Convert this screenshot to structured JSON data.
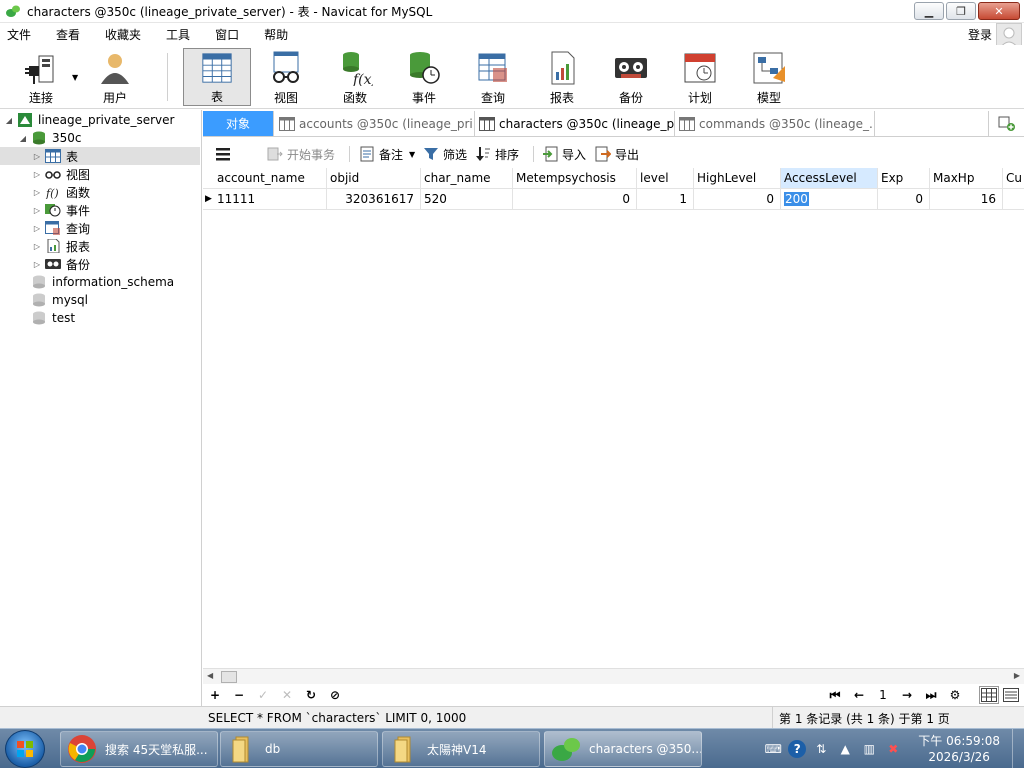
{
  "window": {
    "title": "characters @350c (lineage_private_server) - 表 - Navicat for MySQL",
    "controls": [
      "minimize",
      "restore",
      "close"
    ]
  },
  "menu": {
    "items": [
      "文件",
      "查看",
      "收藏夹",
      "工具",
      "窗口",
      "帮助"
    ],
    "login": "登录"
  },
  "toolbar": {
    "buttons": [
      {
        "label": "连接",
        "icon": "plug-icon"
      },
      {
        "label": "用户",
        "icon": "user-icon"
      },
      {
        "label": "表",
        "icon": "table-icon",
        "active": true
      },
      {
        "label": "视图",
        "icon": "view-glasses-icon"
      },
      {
        "label": "函数",
        "icon": "function-icon"
      },
      {
        "label": "事件",
        "icon": "event-clock-icon"
      },
      {
        "label": "查询",
        "icon": "query-icon"
      },
      {
        "label": "报表",
        "icon": "report-icon"
      },
      {
        "label": "备份",
        "icon": "backup-tape-icon"
      },
      {
        "label": "计划",
        "icon": "calendar-icon"
      },
      {
        "label": "模型",
        "icon": "model-icon"
      }
    ]
  },
  "tree": {
    "connection": "lineage_private_server",
    "database": "350c",
    "nodes": [
      "表",
      "视图",
      "函数",
      "事件",
      "查询",
      "报表",
      "备份"
    ],
    "other_databases": [
      "information_schema",
      "mysql",
      "test"
    ]
  },
  "tabs": [
    {
      "label": "对象"
    },
    {
      "label": "accounts @350c (lineage_pri..."
    },
    {
      "label": "characters @350c (lineage_p..."
    },
    {
      "label": "commands @350c (lineage_..."
    }
  ],
  "table_toolbar": {
    "begin_tx": "开始事务",
    "memo": "备注",
    "filter": "筛选",
    "sort": "排序",
    "import": "导入",
    "export": "导出"
  },
  "grid": {
    "columns": [
      "account_name",
      "objid",
      "char_name",
      "Metempsychosis",
      "level",
      "HighLevel",
      "AccessLevel",
      "Exp",
      "MaxHp",
      "Cu"
    ],
    "rows": [
      [
        "11111",
        "320361617",
        "520",
        "0",
        "1",
        "0",
        "200",
        "0",
        "16",
        ""
      ]
    ],
    "selected_column": "AccessLevel"
  },
  "nav": {
    "page": "1"
  },
  "status": {
    "sql": "SELECT * FROM `characters` LIMIT 0, 1000",
    "record_info": "第 1 条记录 (共 1 条) 于第 1 页"
  },
  "taskbar": {
    "tasks": [
      {
        "label": "搜索 45天堂私服...",
        "icon": "chrome-icon"
      },
      {
        "label": "db",
        "icon": "folder-icon"
      },
      {
        "label": "太陽神V14",
        "icon": "folder-icon"
      },
      {
        "label": "characters @350...",
        "icon": "navicat-icon",
        "active": true
      }
    ],
    "time": "下午 06:59:08",
    "date": "2026/3/26"
  },
  "colors": {
    "accent": "#3b9cff",
    "selected_cell": "#3b8fe8",
    "selected_column_header": "#d6eaff"
  }
}
